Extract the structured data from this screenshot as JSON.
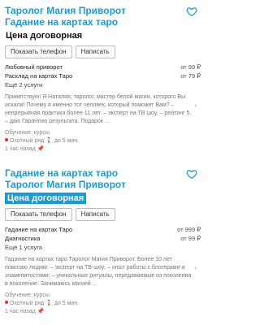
{
  "listings": [
    {
      "title_line1": "Таролог Магия Приворот",
      "title_line2": "Гадание на картах таро",
      "price_label": "Цена договорная",
      "show_phone": "Показать телефон",
      "write": "Написать",
      "services": [
        {
          "name": "Любовный приворот",
          "price": "от 99 ₽"
        },
        {
          "name": "Расклад на картах Таро",
          "price": "от 79 ₽"
        }
      ],
      "more_services": "Ещё 2 услуги",
      "description": "Приветствую! Я Наталия, таролог, мастер белой магии, которого Вы искали! Почему я именно тот человек, который поможет Вам? – непрерывная практика более 11 лет. – эксперт на ТВ шоу. – рейтинг 5. – даю Гарантию результата. Подарок ...",
      "category": "Обучение, курсы",
      "location": "Охотный ряд",
      "distance": "до 5 мин.",
      "time": "1 час назад"
    },
    {
      "title_line1": "Гадание на картах таро",
      "title_line2": "Таролог Магия Приворот",
      "price_label": "Цена договорная",
      "show_phone": "Показать телефон",
      "write": "Написать",
      "services": [
        {
          "name": "Гадание на картах Таро",
          "price": "от 999 ₽"
        },
        {
          "name": "Диагностика",
          "price": "от 99 ₽"
        }
      ],
      "more_services": "Ещё 1 услуга",
      "description": "Гадание на картах таро Таролог Магия Приворот. Более 10 лет помогаю людям: – эксперт на ТВ-шоу; – опыт работы с блогерами и знаменитостями; – уникальные ритуалы, передаваемые из поколения в поколение. Занимаюсь магией ...",
      "category": "Обучение, курсы",
      "location": "Охотный ряд",
      "distance": "до 5 мин.",
      "time": "1 час назад"
    }
  ],
  "colors": {
    "accent": "#1a9bd6",
    "metro": "#d9302c"
  }
}
